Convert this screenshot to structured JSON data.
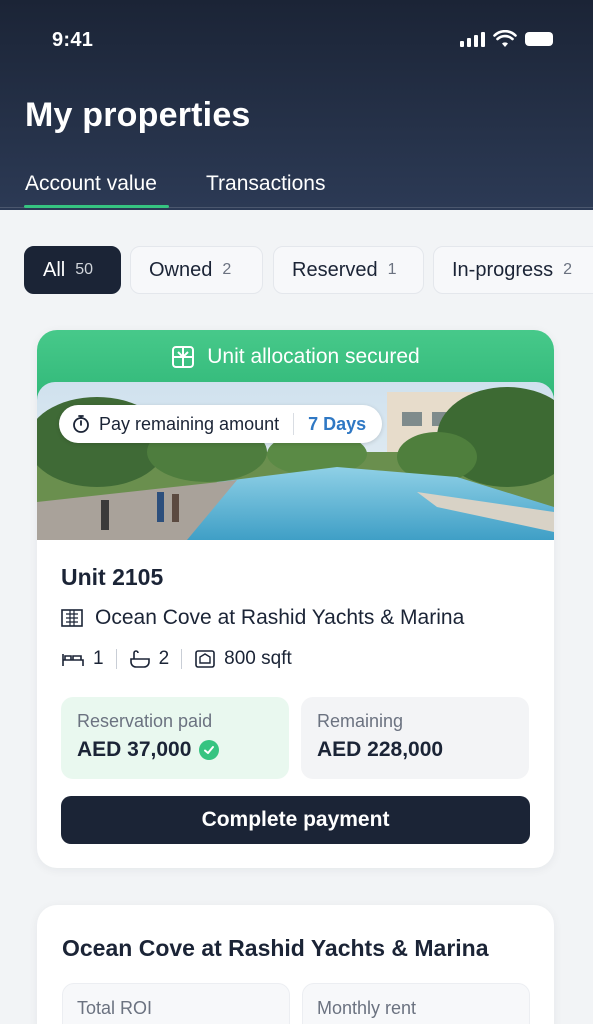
{
  "status_bar": {
    "time": "9:41",
    "icons": [
      "cellular-signal-icon",
      "wifi-icon",
      "battery-icon"
    ]
  },
  "header": {
    "title": "My properties",
    "tabs": [
      {
        "label": "Account value",
        "active": true
      },
      {
        "label": "Transactions",
        "active": false
      }
    ]
  },
  "filters": [
    {
      "label": "All",
      "count": "50",
      "active": true
    },
    {
      "label": "Owned",
      "count": "2",
      "active": false
    },
    {
      "label": "Reserved",
      "count": "1",
      "active": false
    },
    {
      "label": "In-progress",
      "count": "2",
      "active": false
    }
  ],
  "property_card": {
    "banner_text": "Unit allocation secured",
    "banner_icon": "unit-allocation-icon",
    "payment_pill": {
      "label": "Pay remaining amount",
      "days": "7 Days",
      "icon": "stopwatch-icon"
    },
    "unit_title": "Unit 2105",
    "location": "Ocean Cove at Rashid Yachts & Marina",
    "specs": {
      "bedrooms": "1",
      "bathrooms": "2",
      "area": "800 sqft"
    },
    "reservation": {
      "label": "Reservation paid",
      "value": "AED 37,000"
    },
    "remaining": {
      "label": "Remaining",
      "value": "AED 228,000"
    },
    "cta_label": "Complete payment"
  },
  "second_card": {
    "title": "Ocean Cove at Rashid Yachts & Marina",
    "stats": [
      {
        "label": "Total ROI"
      },
      {
        "label": "Monthly rent"
      }
    ]
  },
  "colors": {
    "header_bg": "#1b2436",
    "accent_green": "#36c481",
    "days_blue": "#2f78c4",
    "cta_bg": "#1b2436"
  }
}
